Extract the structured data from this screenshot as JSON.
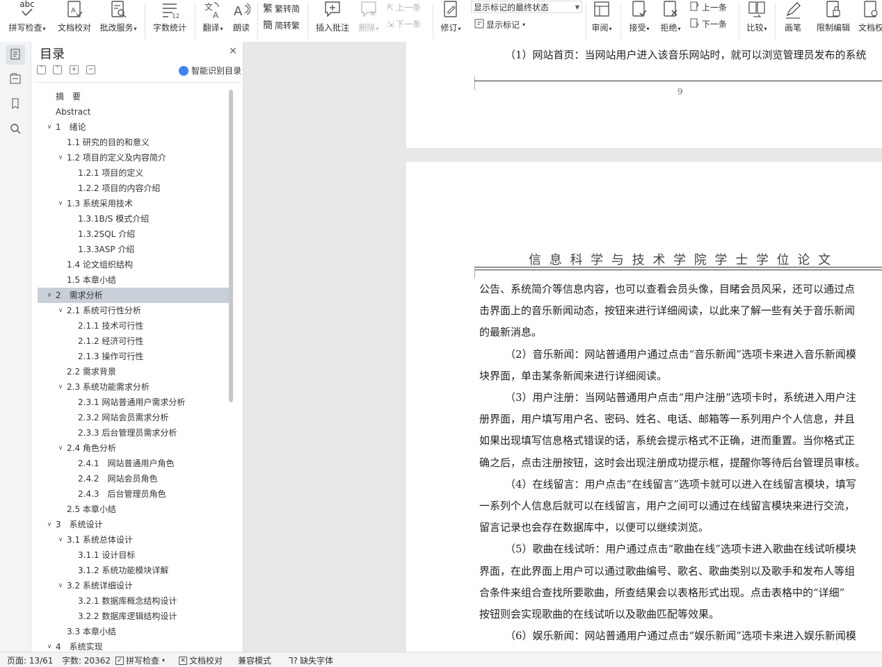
{
  "ribbon": {
    "spell_check": {
      "top": "abc",
      "label": "拼写检查"
    },
    "doc_proof": "文档校对",
    "batch_service": "批改服务",
    "word_count": "字数统计",
    "translate": "翻译",
    "read_aloud": "朗读",
    "trad_simp": "繁转简",
    "simp_trad": "简转繁",
    "insert_comment": "插入批注",
    "delete": "删除",
    "prev_comment": "上一条",
    "next_comment": "下一条",
    "track": "修订",
    "markup_state": "显示标记的最终状态",
    "show_markup": "显示标记",
    "review": "审阅",
    "accept": "接受",
    "reject": "拒绝",
    "prev_change": "上一条",
    "next_change": "下一条",
    "compare": "比较",
    "pen": "画笔",
    "restrict_edit": "限制编辑",
    "doc_rights": "文档权"
  },
  "nav": {
    "title": "目录",
    "smart_toc": "智能识别目录",
    "items": [
      {
        "text": "摘　要",
        "level": 0,
        "chev": false
      },
      {
        "text": "Abstract",
        "level": 0,
        "chev": false
      },
      {
        "text": "1　绪论",
        "level": 0,
        "chev": true
      },
      {
        "text": "1.1 研究的目的和意义",
        "level": 1,
        "chev": false
      },
      {
        "text": "1.2 项目的定义及内容简介",
        "level": 1,
        "chev": true
      },
      {
        "text": "1.2.1 项目的定义",
        "level": 2,
        "chev": false
      },
      {
        "text": "1.2.2 项目的内容介绍",
        "level": 2,
        "chev": false
      },
      {
        "text": "1.3 系统采用技术",
        "level": 1,
        "chev": true
      },
      {
        "text": "1.3.1B/S 模式介绍",
        "level": 2,
        "chev": false
      },
      {
        "text": "1.3.2SQL 介绍",
        "level": 2,
        "chev": false
      },
      {
        "text": "1.3.3ASP 介绍",
        "level": 2,
        "chev": false
      },
      {
        "text": "1.4 论文组织结构",
        "level": 1,
        "chev": false
      },
      {
        "text": "1.5 本章小结",
        "level": 1,
        "chev": false
      },
      {
        "text": "2　需求分析",
        "level": 0,
        "chev": true,
        "selected": true
      },
      {
        "text": "2.1 系统可行性分析",
        "level": 1,
        "chev": true
      },
      {
        "text": "2.1.1 技术可行性",
        "level": 2,
        "chev": false
      },
      {
        "text": "2.1.2 经济可行性",
        "level": 2,
        "chev": false
      },
      {
        "text": "2.1.3 操作可行性",
        "level": 2,
        "chev": false
      },
      {
        "text": "2.2 需求背景",
        "level": 1,
        "chev": false
      },
      {
        "text": "2.3 系统功能需求分析",
        "level": 1,
        "chev": true
      },
      {
        "text": "2.3.1 网站普通用户需求分析",
        "level": 2,
        "chev": false
      },
      {
        "text": "2.3.2 网站会员需求分析",
        "level": 2,
        "chev": false
      },
      {
        "text": "2.3.3 后台管理员需求分析",
        "level": 2,
        "chev": false
      },
      {
        "text": "2.4 角色分析",
        "level": 1,
        "chev": true
      },
      {
        "text": "2.4.1　网站普通用户角色",
        "level": 2,
        "chev": false
      },
      {
        "text": "2.4.2　网站会员角色",
        "level": 2,
        "chev": false
      },
      {
        "text": "2.4.3　后台管理员角色",
        "level": 2,
        "chev": false
      },
      {
        "text": "2.5 本章小结",
        "level": 1,
        "chev": false
      },
      {
        "text": "3　系统设计",
        "level": 0,
        "chev": true
      },
      {
        "text": "3.1 系统总体设计",
        "level": 1,
        "chev": true
      },
      {
        "text": "3.1.1 设计目标",
        "level": 2,
        "chev": false
      },
      {
        "text": "3.1.2 系统功能模块详解",
        "level": 2,
        "chev": false
      },
      {
        "text": "3.2 系统详细设计",
        "level": 1,
        "chev": true
      },
      {
        "text": "3.2.1 数据库概念结构设计",
        "level": 2,
        "chev": false
      },
      {
        "text": "3.2.2 数据库逻辑结构设计",
        "level": 2,
        "chev": false
      },
      {
        "text": "3.3 本章小结",
        "level": 1,
        "chev": false
      },
      {
        "text": "4　系统实现",
        "level": 0,
        "chev": true
      }
    ]
  },
  "doc": {
    "page1_line": "（1）网站首页：当网站用户进入该音乐网站时，就可以浏览管理员发布的系统",
    "page_number": "9",
    "header": "信 息 科 学 与 技 术 学 院 学 士 学 位 论 文",
    "lines": [
      {
        "t": "公告、系统简介等信息内容，也可以查看会员头像，目睹会员风采，还可以通过点",
        "indent": false
      },
      {
        "t": "击界面上的音乐新闻动态，按钮来进行详细阅读，以此来了解一些有关于音乐新闻",
        "indent": false
      },
      {
        "t": "的最新消息。",
        "indent": false
      },
      {
        "t": "（2）音乐新闻：网站普通用户通过点击“音乐新闻”选项卡来进入音乐新闻模",
        "indent": true
      },
      {
        "t": "块界面，单击某条新闻来进行详细阅读。",
        "indent": false
      },
      {
        "t": "（3）用户注册：当网站普通用户点击“用户注册”选项卡时，系统进入用户注",
        "indent": true
      },
      {
        "t": "册界面，用户填写用户名、密码、姓名、电话、邮箱等一系列用户个人信息，并且",
        "indent": false
      },
      {
        "t": "如果出现填写信息格式错误的话，系统会提示格式不正确，进而重置。当你格式正",
        "indent": false
      },
      {
        "t": "确之后，点击注册按钮，这时会出现注册成功提示框，提醒你等待后台管理员审核。",
        "indent": false
      },
      {
        "t": "（4）在线留言：用户点击“在线留言”选项卡就可以进入在线留言模块，填写",
        "indent": true
      },
      {
        "t": "一系列个人信息后就可以在线留言，用户之间可以通过在线留言模块来进行交流，",
        "indent": false
      },
      {
        "t": "留言记录也会存在数据库中，以便可以继续浏览。",
        "indent": false
      },
      {
        "t": "（5）歌曲在线试听：用户通过点击“歌曲在线”选项卡进入歌曲在线试听模块",
        "indent": true
      },
      {
        "t": "界面，在此界面上用户可以通过歌曲编号、歌名、歌曲类别以及歌手和发布人等组",
        "indent": false
      },
      {
        "t": "合条件来组合查找所要歌曲，所查结果会以表格形式出现。点击表格中的“详细”",
        "indent": false
      },
      {
        "t": "按钮则会实现歌曲的在线试听以及歌曲匹配等效果。",
        "indent": false
      },
      {
        "t": "（6）娱乐新闻：网站普通用户通过点击“娱乐新闻”选项卡来进入娱乐新闻模",
        "indent": true
      }
    ]
  },
  "status": {
    "page": "页面: 13/61",
    "words": "字数: 20362",
    "spell": "拼写检查",
    "proof": "文档校对",
    "compat": "兼容模式",
    "missing_font": "缺失字体"
  }
}
